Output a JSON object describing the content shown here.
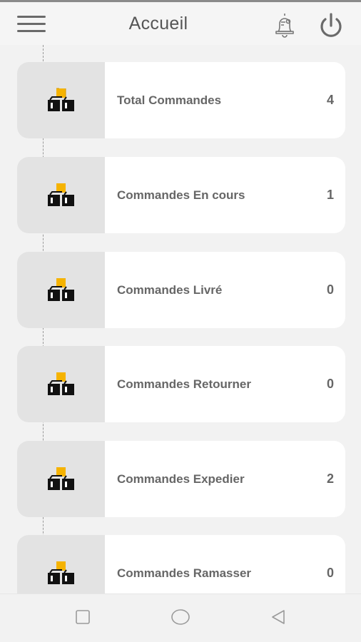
{
  "header": {
    "title": "Accueil",
    "menu_icon": "hamburger-menu-icon",
    "notification_icon": "bell-icon",
    "logout_icon": "power-icon"
  },
  "cards": [
    {
      "label": "Total Commandes",
      "count": "4",
      "icon": "boxes-icon"
    },
    {
      "label": "Commandes En cours",
      "count": "1",
      "icon": "boxes-icon"
    },
    {
      "label": "Commandes Livré",
      "count": "0",
      "icon": "boxes-icon"
    },
    {
      "label": "Commandes Retourner",
      "count": "0",
      "icon": "boxes-icon"
    },
    {
      "label": "Commandes Expedier",
      "count": "2",
      "icon": "boxes-icon"
    },
    {
      "label": "Commandes Ramasser",
      "count": "0",
      "icon": "boxes-icon"
    }
  ],
  "navbar": {
    "items": [
      "recents-square-icon",
      "home-circle-icon",
      "back-triangle-icon"
    ]
  },
  "colors": {
    "accent": "#f5b301",
    "box_dark": "#111111",
    "thumb_bg": "#e3e3e3",
    "text": "#666666"
  }
}
